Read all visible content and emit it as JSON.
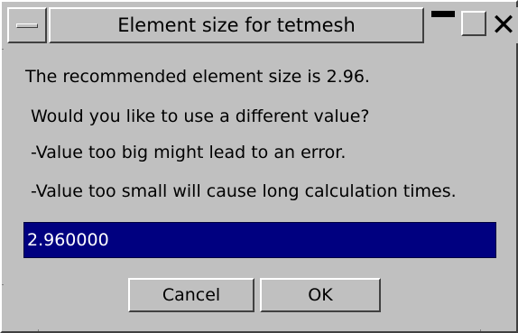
{
  "window": {
    "title": "Element size for tetmesh"
  },
  "message": {
    "line1": "The recommended element size is 2.96.",
    "line2": "Would you like to use a different value?",
    "line3": "-Value too big might lead to an error.",
    "line4": "-Value too small will cause long calculation times."
  },
  "input": {
    "value": "2.960000"
  },
  "buttons": {
    "cancel_label": "Cancel",
    "ok_label": "OK"
  },
  "colors": {
    "background": "#c0c0c0",
    "field_selection": "#000080",
    "field_text": "#ffffff"
  },
  "icons": {
    "window_menu": "window-menu-icon",
    "minimize": "minimize-icon",
    "maximize": "maximize-icon",
    "close": "close-icon"
  }
}
